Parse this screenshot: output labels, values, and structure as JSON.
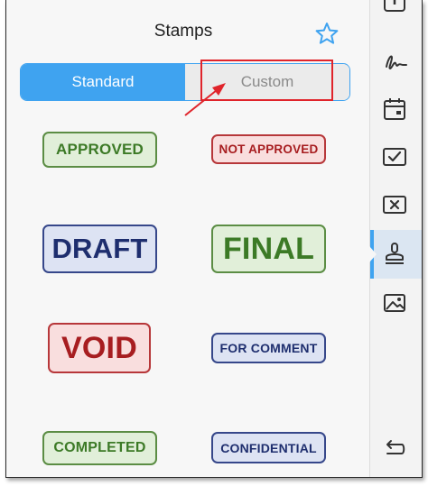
{
  "header": {
    "title": "Stamps"
  },
  "tabs": [
    {
      "label": "Standard",
      "active": true
    },
    {
      "label": "Custom",
      "active": false
    }
  ],
  "stamps": [
    {
      "label": "APPROVED",
      "color": "green"
    },
    {
      "label": "NOT APPROVED",
      "color": "red"
    },
    {
      "label": "DRAFT",
      "color": "blue"
    },
    {
      "label": "FINAL",
      "color": "green"
    },
    {
      "label": "VOID",
      "color": "red"
    },
    {
      "label": "FOR COMMENT",
      "color": "blue"
    },
    {
      "label": "COMPLETED",
      "color": "green"
    },
    {
      "label": "CONFIDENTIAL",
      "color": "blue"
    }
  ],
  "sidebar": {
    "icons": [
      "signature-icon",
      "calendar-icon",
      "checkmark-stamp-icon",
      "x-stamp-icon",
      "stamp-icon",
      "image-icon",
      "undo-icon"
    ],
    "active": "stamp-icon"
  },
  "colors": {
    "accent": "#3fa3f0",
    "annotation": "#e0242b",
    "green": "#3c7a26",
    "red": "#a71d20",
    "blue": "#1e2e6e"
  }
}
